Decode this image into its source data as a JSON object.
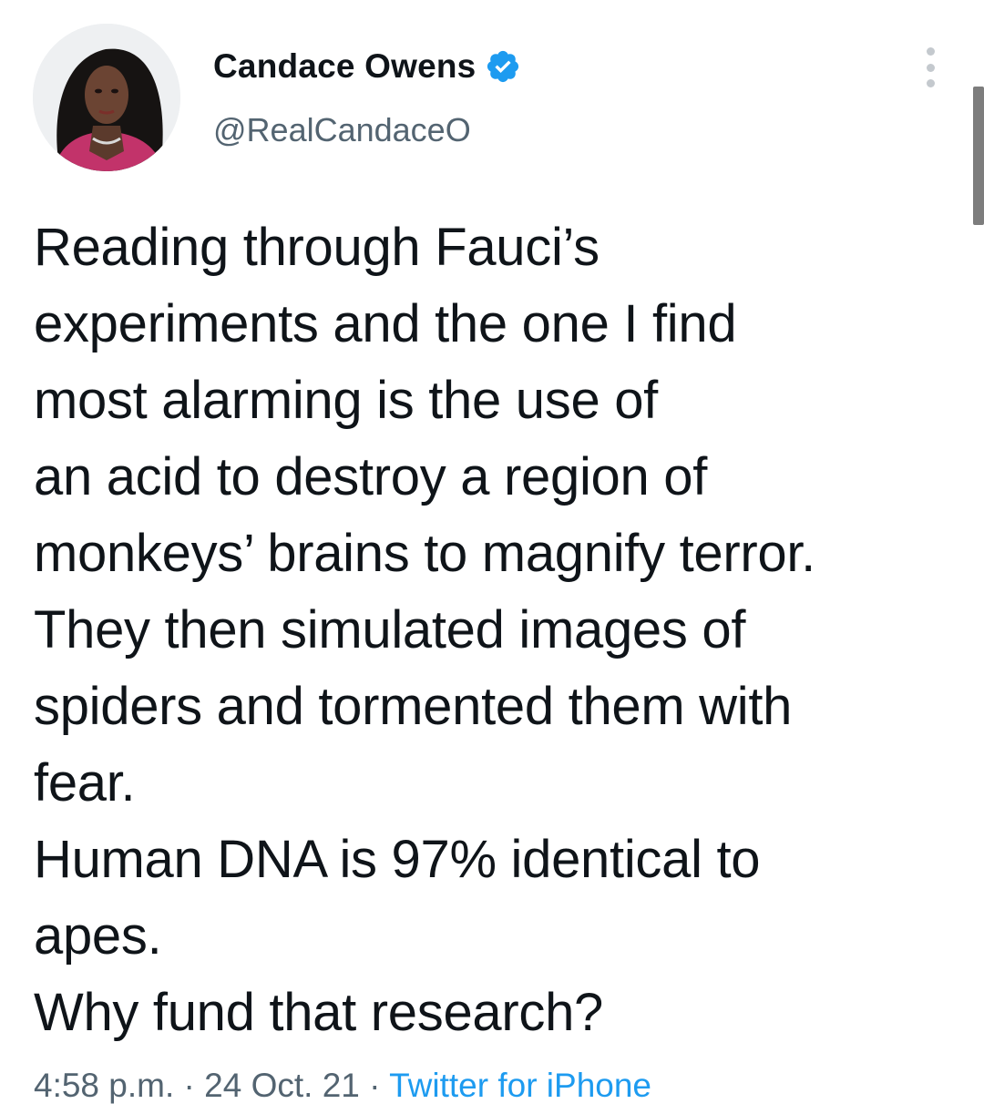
{
  "author": {
    "name": "Candace Owens",
    "handle": "@RealCandaceO",
    "verified": true,
    "avatar_icon": "profile-photo"
  },
  "tweet": {
    "lines": [
      "Reading through Fauci’s",
      "experiments and the one I find",
      "most alarming is the use of",
      "an acid to destroy a region of",
      "monkeys’ brains to magnify terror.",
      "They then simulated images of",
      "spiders and tormented them with",
      "fear.",
      "Human DNA is 97% identical to",
      "apes.",
      "Why fund that research?"
    ]
  },
  "meta": {
    "time": "4:58 p.m.",
    "separator": " · ",
    "date": "24 Oct. 21",
    "source": "Twitter for iPhone"
  },
  "colors": {
    "text": "#0f1419",
    "secondary": "#536471",
    "link": "#1d9bf0",
    "verified_badge": "#1d9bf0"
  }
}
